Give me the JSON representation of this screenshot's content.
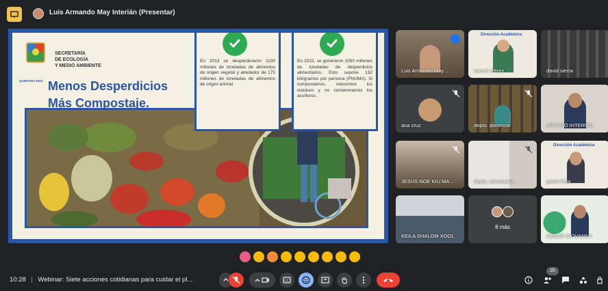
{
  "header": {
    "presenter_title": "Luis Armando May Interián (Presentar)"
  },
  "slide": {
    "secretaria": "SECRETARÍA",
    "ecologia": "DE ECOLOGÍA",
    "medio_ambiente": "Y MEDIO AMBIENTE",
    "logo_caption": "QUINTANA ROO",
    "headline_line1": "Menos Desperdicios",
    "headline_line2": "Más Compostaje.",
    "card1_text": "En 2013 se desperdiciaron 1100 millones de toneladas de alimentos de origen vegetal y alrededor de 175 millones de toneladas de alimentos de origen animal.",
    "card2_text": "En 2022, se generaron 1050 millones de toneladas de desperdicios alimentarios. Esto supone 132 kilogramos por persona (PNUMA). Si compostamos, reducimos los residuos y no contaminamos los acuíferos."
  },
  "participants": [
    {
      "name": "Luis Armando May ..."
    },
    {
      "name": "cuenta Pérez"
    },
    {
      "name": "david sierra"
    },
    {
      "name": "ana cruz"
    },
    {
      "name": "depto. docencia"
    },
    {
      "name": "ARTURO INTERIAN"
    },
    {
      "name": "JESUS NOE KIU MA..."
    },
    {
      "name": "depto. orientacion"
    },
    {
      "name": "pedro flota"
    },
    {
      "name": "KEILA SHALOM XOOL"
    },
    {
      "name": "8 más"
    },
    {
      "name": "CESAR GIOVANNY"
    }
  ],
  "tile_labels": {
    "direccion1": "Dirección Académica",
    "direccion2": "Dirección Académica"
  },
  "bottom": {
    "time": "10:28",
    "separator": "|",
    "meeting_title": "Webinar: Siete acciones cotidianas para cuidar el pl...",
    "participant_count": "20"
  },
  "colors": {
    "slide_blue": "#2a56a6",
    "check_green": "#2eaa52",
    "hangup_red": "#ea4335",
    "mic_off_red": "#ea4335"
  }
}
